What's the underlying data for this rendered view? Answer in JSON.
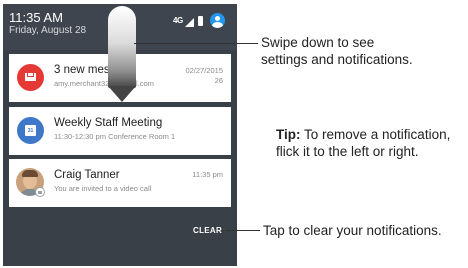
{
  "status_bar": {
    "time": "11:35 AM",
    "date": "Friday, August 28",
    "network_label": "4G",
    "user_icon": "account-circle-icon"
  },
  "notifications": [
    {
      "app_icon": "gmail-icon",
      "title": "3 new mes",
      "subtitle": "amy.merchant32",
      "subtitle_suffix": "gmail.com",
      "date": "02/27/2015",
      "count": "26"
    },
    {
      "app_icon": "calendar-icon",
      "calendar_day": "31",
      "title": "Weekly Staff Meeting",
      "subtitle": "11:30-12:30 pm Conference Room 1"
    },
    {
      "app_icon": "contact-avatar",
      "title": "Craig Tanner",
      "subtitle": "You are invited to a video call",
      "time": "11:35 pm"
    }
  ],
  "clear_label": "CLEAR",
  "callouts": {
    "swipe": [
      "Swipe down to see",
      "settings and notifications."
    ],
    "tip_bold": "Tip:",
    "tip_text_1": " To remove a notification,",
    "tip_text_2": "flick it to the left or right.",
    "clear": "Tap to clear your notifications."
  },
  "colors": {
    "shade_bg": "#3a4048",
    "gmail_red": "#e53935",
    "calendar_blue": "#3f78c8",
    "account_blue": "#2196f3"
  }
}
